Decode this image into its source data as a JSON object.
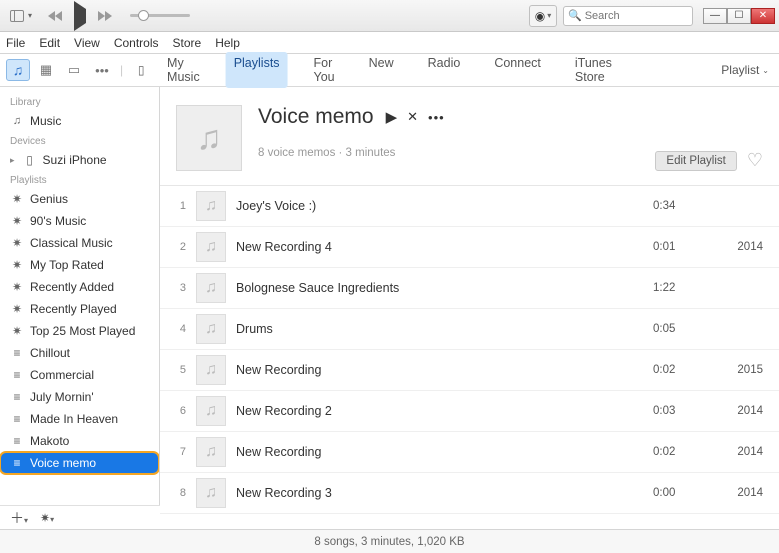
{
  "titlebar": {
    "search_placeholder": "Search"
  },
  "menubar": [
    "File",
    "Edit",
    "View",
    "Controls",
    "Store",
    "Help"
  ],
  "nav": {
    "items": [
      "My Music",
      "Playlists",
      "For You",
      "New",
      "Radio",
      "Connect",
      "iTunes Store"
    ],
    "selected_index": 1,
    "right_label": "Playlist"
  },
  "sidebar": {
    "library_heading": "Library",
    "library_items": [
      {
        "icon": "note",
        "label": "Music"
      }
    ],
    "devices_heading": "Devices",
    "devices_items": [
      {
        "icon": "phone",
        "label": "Suzi iPhone"
      }
    ],
    "playlists_heading": "Playlists",
    "playlists_items": [
      {
        "icon": "gear",
        "label": "Genius"
      },
      {
        "icon": "gear",
        "label": "90's Music"
      },
      {
        "icon": "gear",
        "label": "Classical Music"
      },
      {
        "icon": "gear",
        "label": "My Top Rated"
      },
      {
        "icon": "gear",
        "label": "Recently Added"
      },
      {
        "icon": "gear",
        "label": "Recently Played"
      },
      {
        "icon": "gear",
        "label": "Top 25 Most Played"
      },
      {
        "icon": "list",
        "label": "Chillout"
      },
      {
        "icon": "list",
        "label": "Commercial"
      },
      {
        "icon": "list",
        "label": "July Mornin'"
      },
      {
        "icon": "list",
        "label": "Made In Heaven"
      },
      {
        "icon": "list",
        "label": "Makoto"
      },
      {
        "icon": "list",
        "label": "Voice memo",
        "selected": true
      }
    ]
  },
  "playlist": {
    "title": "Voice memo",
    "subtitle": "8 voice memos · 3 minutes",
    "edit_label": "Edit Playlist",
    "tracks": [
      {
        "n": 1,
        "name": "Joey's Voice :)",
        "dur": "0:34",
        "year": ""
      },
      {
        "n": 2,
        "name": "New Recording 4",
        "dur": "0:01",
        "year": "2014"
      },
      {
        "n": 3,
        "name": "Bolognese Sauce Ingredients",
        "dur": "1:22",
        "year": ""
      },
      {
        "n": 4,
        "name": "Drums",
        "dur": "0:05",
        "year": ""
      },
      {
        "n": 5,
        "name": "New Recording",
        "dur": "0:02",
        "year": "2015"
      },
      {
        "n": 6,
        "name": "New Recording 2",
        "dur": "0:03",
        "year": "2014"
      },
      {
        "n": 7,
        "name": "New Recording",
        "dur": "0:02",
        "year": "2014"
      },
      {
        "n": 8,
        "name": "New Recording 3",
        "dur": "0:00",
        "year": "2014"
      }
    ]
  },
  "statusbar": "8 songs, 3 minutes, 1,020 KB"
}
